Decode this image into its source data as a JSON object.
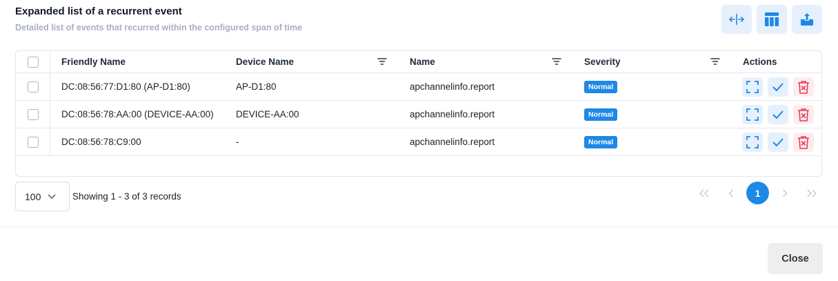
{
  "dialog": {
    "title": "Expanded list of a recurrent event",
    "subtitle": "Detailed list of events that recurred within the configured span of time",
    "toolbar": [
      {
        "icon": "column-width-icon"
      },
      {
        "icon": "columns-layout-icon"
      },
      {
        "icon": "export-upload-icon"
      }
    ]
  },
  "table": {
    "columns": {
      "friendly_name": "Friendly Name",
      "device_name": "Device Name",
      "name": "Name",
      "severity": "Severity",
      "actions": "Actions"
    },
    "rows": [
      {
        "friendly_name": "DC:08:56:77:D1:80 (AP-D1:80)",
        "device_name": "AP-D1:80",
        "name": "apchannelinfo.report",
        "severity": "Normal"
      },
      {
        "friendly_name": "DC:08:56:78:AA:00 (DEVICE-AA:00)",
        "device_name": "DEVICE-AA:00",
        "name": "apchannelinfo.report",
        "severity": "Normal"
      },
      {
        "friendly_name": "DC:08:56:78:C9:00",
        "device_name": "-",
        "name": "apchannelinfo.report",
        "severity": "Normal"
      }
    ],
    "severity_color": "#1e88e5"
  },
  "footer": {
    "page_size": "100",
    "records_text": "Showing 1 - 3 of 3 records",
    "current_page": "1"
  },
  "close_label": "Close"
}
